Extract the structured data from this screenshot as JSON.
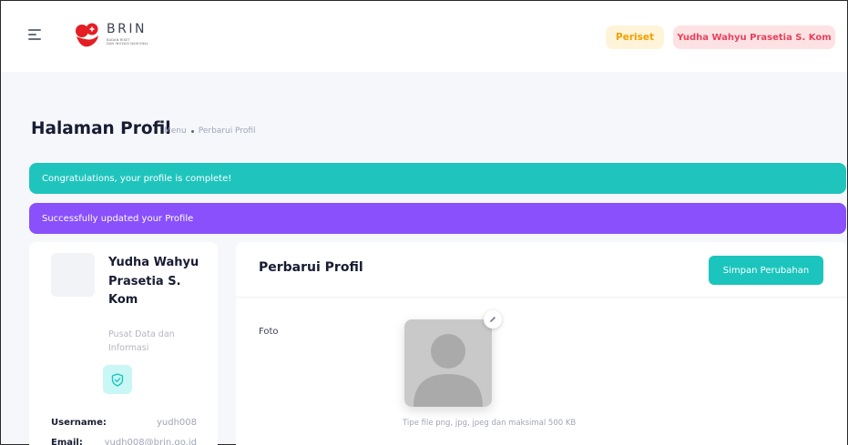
{
  "header": {
    "logo": {
      "brand": "BRIN",
      "subtitle_line1": "BADAN RISET",
      "subtitle_line2": "DAN INOVASI NASIONAL",
      "colors": {
        "red": "#e31e24"
      }
    },
    "role_badge": "Periset",
    "user_badge": "Yudha Wahyu Prasetia S. Kom",
    "menu_icon": "hamburger-icon"
  },
  "page": {
    "title": "Halaman Profil",
    "breadcrumb": [
      "Menu",
      "Perbarui Profil"
    ]
  },
  "alerts": {
    "complete": "Congratulations, your profile is complete!",
    "updated": "Successfully updated your Profile"
  },
  "profile_card": {
    "name": "Yudha Wahyu Prasetia S. Kom",
    "unit": "Pusat Data dan Informasi",
    "shield_icon": "shield-check-icon",
    "username_label": "Username:",
    "username_value": "yudh008",
    "email_label": "Email:",
    "email_value": "yudh008@brin.go.id"
  },
  "form": {
    "title": "Perbarui Profil",
    "save_label": "Simpan Perubahan",
    "photo_label": "Foto",
    "photo_hint": "Tipe file png, jpg, jpeg dan maksimal 500 KB",
    "edit_icon": "pencil-icon"
  },
  "colors": {
    "success": "#1fc5bd",
    "info": "#8950fc",
    "warning_bg": "#fff4d9",
    "warning_text": "#f0a000",
    "danger_bg": "#fde2e4",
    "danger_text": "#e6425b"
  }
}
